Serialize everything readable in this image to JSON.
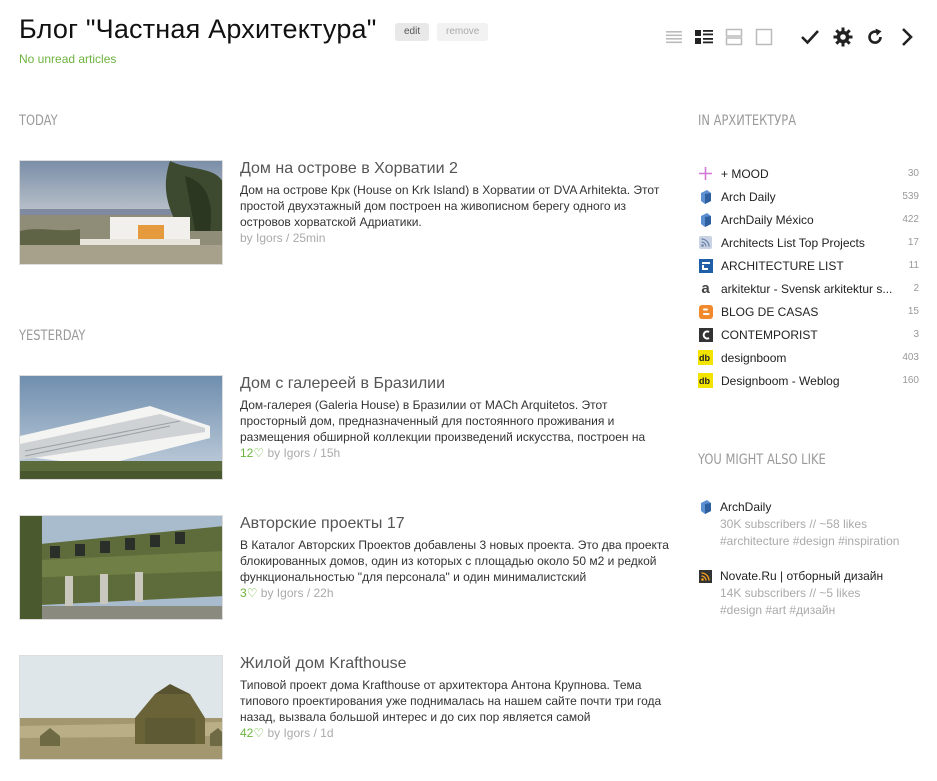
{
  "header": {
    "title": "Блог \"Частная Архитектура\"",
    "edit_label": "edit",
    "remove_label": "remove",
    "unread_status": "No unread articles"
  },
  "toolbar": {
    "icons": [
      "list-view-icon",
      "magazine-view-icon",
      "cards-view-icon",
      "full-article-view-icon",
      "mark-as-read-icon",
      "settings-icon",
      "refresh-icon",
      "next-icon"
    ]
  },
  "sections": {
    "today": "TODAY",
    "yesterday": "YESTERDAY"
  },
  "articles": [
    {
      "title": "Дом на острове в Хорватии 2",
      "summary": "Дом на острове Крк (House on Krk Island) в Хорватии от DVA Arhitekta. Этот простой двухэтажный дом построен на живописном берегу одного из островов хорватской Адриатики.",
      "likes": "",
      "meta": "by Igors / 25min"
    },
    {
      "title": "Дом с галереей в Бразилии",
      "summary": "Дом-галерея (Galeria House) в Бразилии от MACh Arquitetos. Этот просторный дом, предназначенный для постоянного проживания и размещения обширной коллекции произведений искусства, построен на",
      "likes": "12",
      "meta": "by Igors / 15h"
    },
    {
      "title": "Авторские проекты 17",
      "summary": "В Каталог Авторских Проектов добавлены 3 новых проекта. Это два проекта блокированных домов, один из которых с площадью около 50 м2 и редкой функциональностью \"для персонала\" и один минималистский",
      "likes": "3",
      "meta": "by Igors / 22h"
    },
    {
      "title": "Жилой дом Krafthouse",
      "summary": "Типовой проект дома Krafthouse от архитектора Антона Крупнова. Тема типового проектирования уже поднималась на нашем сайте почти три года назад, вызвала большой интерес и до сих пор является самой",
      "likes": "42",
      "meta": "by Igors / 1d"
    }
  ],
  "sidebar": {
    "category_heading": "IN АРХИТЕКТУРА",
    "feeds": [
      {
        "name": "+ MOOD",
        "count": "30",
        "icon": "mood-icon"
      },
      {
        "name": "Arch Daily",
        "count": "539",
        "icon": "archdaily-icon"
      },
      {
        "name": "ArchDaily México",
        "count": "422",
        "icon": "archdaily-icon"
      },
      {
        "name": "Architects List Top Projects",
        "count": "17",
        "icon": "rss-icon"
      },
      {
        "name": "ARCHITECTURE LIST",
        "count": "11",
        "icon": "architecture-list-icon"
      },
      {
        "name": "arkitektur - Svensk arkitektur s...",
        "count": "2",
        "icon": "arkitektur-icon"
      },
      {
        "name": "BLOG DE CASAS",
        "count": "15",
        "icon": "blogger-icon"
      },
      {
        "name": "CONTEMPORIST",
        "count": "3",
        "icon": "contemporist-icon"
      },
      {
        "name": "designboom",
        "count": "403",
        "icon": "designboom-icon"
      },
      {
        "name": "Designboom - Weblog",
        "count": "160",
        "icon": "designboom-icon"
      }
    ],
    "suggest_heading": "YOU MIGHT ALSO LIKE",
    "suggestions": [
      {
        "name": "ArchDaily",
        "stats": "30K subscribers // ~58 likes",
        "tags": "#architecture #design #inspiration",
        "icon": "archdaily-icon"
      },
      {
        "name": "Novate.Ru | отборный дизайн",
        "stats": "14K subscribers // ~5 likes",
        "tags": "#design #art #дизайн",
        "icon": "rss-icon"
      }
    ]
  },
  "colors": {
    "accent_green": "#6db33f",
    "muted": "#9a9a9a"
  }
}
